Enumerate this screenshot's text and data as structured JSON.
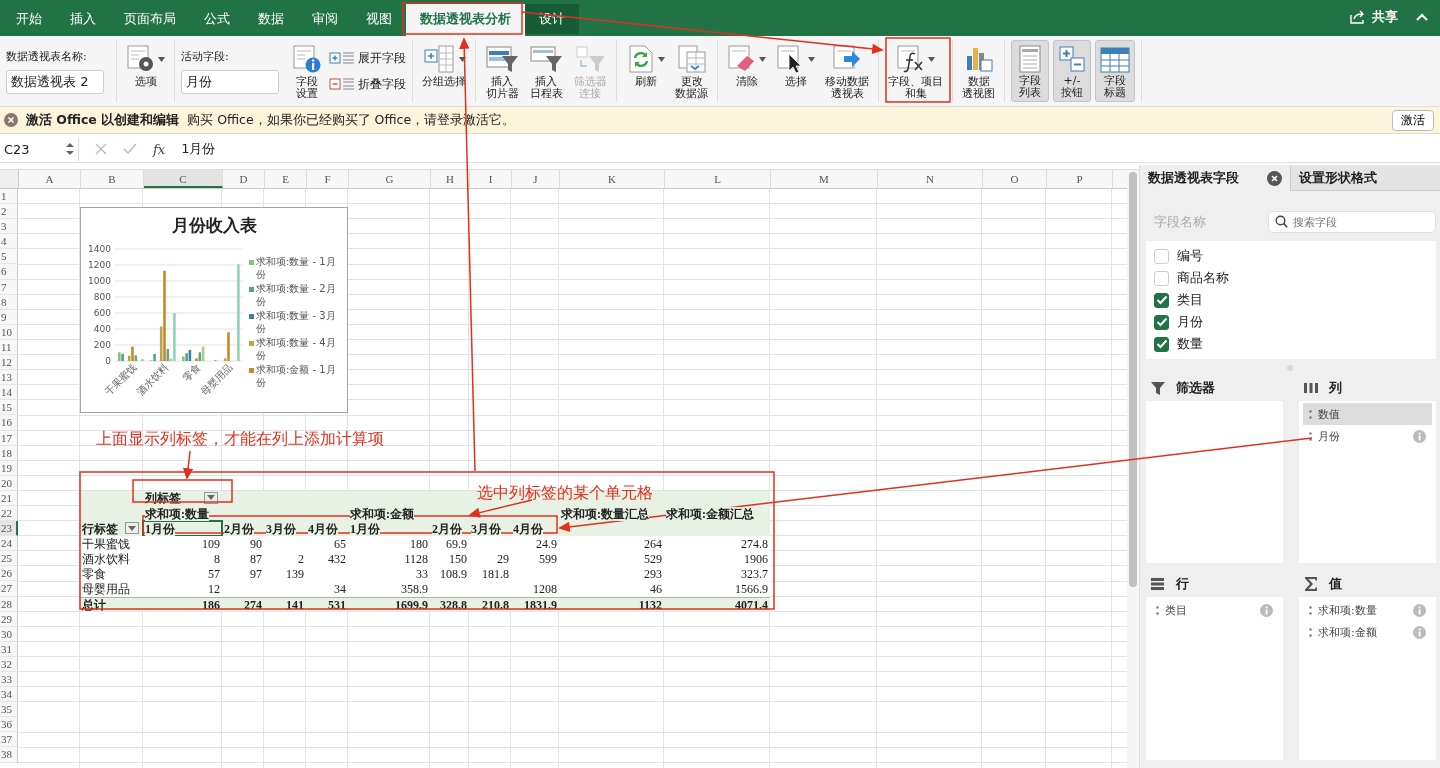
{
  "tabs": [
    {
      "label": "开始",
      "selected": false,
      "contextual": false
    },
    {
      "label": "插入",
      "selected": false,
      "contextual": false
    },
    {
      "label": "页面布局",
      "selected": false,
      "contextual": false
    },
    {
      "label": "公式",
      "selected": false,
      "contextual": false
    },
    {
      "label": "数据",
      "selected": false,
      "contextual": false
    },
    {
      "label": "审阅",
      "selected": false,
      "contextual": false
    },
    {
      "label": "视图",
      "selected": false,
      "contextual": false
    },
    {
      "label": "数据透视表分析",
      "selected": true,
      "contextual": true
    },
    {
      "label": "设计",
      "selected": false,
      "contextual": true
    }
  ],
  "share": {
    "label": "共享"
  },
  "ribbon": {
    "groups": [
      {
        "items": [
          {
            "kind": "field",
            "label": "数据透视表名称:",
            "value": "数据透视表 2"
          }
        ]
      },
      {
        "items": [
          {
            "kind": "large",
            "lines": [
              "选项"
            ],
            "caret": true
          }
        ]
      },
      {
        "items": [
          {
            "kind": "field",
            "label": "活动字段:",
            "value": "月份"
          },
          {
            "kind": "large",
            "lines": [
              "字段",
              "设置"
            ]
          },
          {
            "kind": "pair",
            "buttons": [
              {
                "label": "展开字段"
              },
              {
                "label": "折叠字段"
              }
            ]
          }
        ]
      },
      {
        "items": [
          {
            "kind": "large",
            "lines": [
              "分组选择"
            ],
            "caret": true
          }
        ]
      },
      {
        "items": [
          {
            "kind": "large",
            "lines": [
              "插入",
              "切片器"
            ],
            "disabled": false
          },
          {
            "kind": "large",
            "lines": [
              "插入",
              "日程表"
            ],
            "disabled": false
          },
          {
            "kind": "large",
            "lines": [
              "筛选器",
              "连接"
            ],
            "disabled": true
          }
        ]
      },
      {
        "items": [
          {
            "kind": "large",
            "lines": [
              "刷新"
            ],
            "caret": true
          },
          {
            "kind": "large",
            "lines": [
              "更改",
              "数据源"
            ]
          }
        ]
      },
      {
        "items": [
          {
            "kind": "large",
            "lines": [
              "清除"
            ],
            "caret": true
          },
          {
            "kind": "large",
            "lines": [
              "选择"
            ],
            "caret": true
          },
          {
            "kind": "large",
            "lines": [
              "移动数据",
              "透视表"
            ]
          }
        ]
      },
      {
        "items": [
          {
            "kind": "large",
            "lines": [
              "字段、项目",
              "和集"
            ],
            "caret": true
          }
        ]
      },
      {
        "items": [
          {
            "kind": "large",
            "lines": [
              "数据",
              "透视图"
            ]
          }
        ]
      },
      {
        "items": [
          {
            "kind": "large",
            "lines": [
              "字段",
              "列表"
            ],
            "on": true
          },
          {
            "kind": "large",
            "lines": [
              "+/-",
              "按钮"
            ],
            "on": true
          },
          {
            "kind": "large",
            "lines": [
              "字段",
              "标题"
            ],
            "on": true
          }
        ]
      }
    ]
  },
  "message_bar": {
    "title": "激活 Office 以创建和编辑",
    "text": "购买 Office，如果你已经购买了 Office，请登录激活它。",
    "button": "激活"
  },
  "formula_bar": {
    "name_box": "C23",
    "function_label": "fx",
    "value": "1月份"
  },
  "sheet": {
    "columns": [
      {
        "letter": "A",
        "selected": false
      },
      {
        "letter": "B",
        "selected": false
      },
      {
        "letter": "C",
        "selected": true
      },
      {
        "letter": "D",
        "selected": false
      },
      {
        "letter": "E",
        "selected": false
      },
      {
        "letter": "F",
        "selected": false
      },
      {
        "letter": "G",
        "selected": false
      },
      {
        "letter": "H",
        "selected": false
      },
      {
        "letter": "I",
        "selected": false
      },
      {
        "letter": "J",
        "selected": false
      },
      {
        "letter": "K",
        "selected": false
      },
      {
        "letter": "L",
        "selected": false
      },
      {
        "letter": "M",
        "selected": false
      },
      {
        "letter": "N",
        "selected": false
      },
      {
        "letter": "O",
        "selected": false
      },
      {
        "letter": "P",
        "selected": false
      }
    ],
    "rows": [
      {
        "number": "1",
        "selected": false
      },
      {
        "number": "2",
        "selected": false
      },
      {
        "number": "3",
        "selected": false
      },
      {
        "number": "4",
        "selected": false
      },
      {
        "number": "5",
        "selected": false
      },
      {
        "number": "6",
        "selected": false
      },
      {
        "number": "7",
        "selected": false
      },
      {
        "number": "8",
        "selected": false
      },
      {
        "number": "9",
        "selected": false
      },
      {
        "number": "10",
        "selected": false
      },
      {
        "number": "11",
        "selected": false
      },
      {
        "number": "12",
        "selected": false
      },
      {
        "number": "13",
        "selected": false
      },
      {
        "number": "14",
        "selected": false
      },
      {
        "number": "15",
        "selected": false
      },
      {
        "number": "16",
        "selected": false
      },
      {
        "number": "17",
        "selected": false
      },
      {
        "number": "18",
        "selected": false
      },
      {
        "number": "19",
        "selected": false
      },
      {
        "number": "20",
        "selected": false
      },
      {
        "number": "21",
        "selected": false,
        "kind": "pivot_head",
        "cells": [
          null,
          null,
          {
            "text": "列标签",
            "dropdown": true
          }
        ]
      },
      {
        "number": "22",
        "selected": false,
        "kind": "pivot_head",
        "cells": [
          null,
          null,
          "求和项:数量",
          null,
          null,
          null,
          "求和项:金额",
          null,
          null,
          null,
          "求和项:数量汇总",
          "求和项:金额汇总"
        ]
      },
      {
        "number": "23",
        "selected": true,
        "kind": "pivot_head",
        "cells": [
          null,
          {
            "text": "行标签",
            "dropdown": true
          },
          "1月份",
          "2月份",
          "3月份",
          "4月份",
          "1月份",
          "2月份",
          "3月份",
          "4月份"
        ]
      },
      {
        "number": "24",
        "selected": false,
        "kind": "pivot_data",
        "cells": [
          null,
          "干果蜜饯",
          "109",
          "90",
          null,
          "65",
          "180",
          "69.9",
          null,
          "24.9",
          "264",
          "274.8"
        ]
      },
      {
        "number": "25",
        "selected": false,
        "kind": "pivot_data",
        "cells": [
          null,
          "酒水饮料",
          "8",
          "87",
          "2",
          "432",
          "1128",
          "150",
          "29",
          "599",
          "529",
          "1906"
        ]
      },
      {
        "number": "26",
        "selected": false,
        "kind": "pivot_data",
        "cells": [
          null,
          "零食",
          "57",
          "97",
          "139",
          null,
          "33",
          "108.9",
          "181.8",
          null,
          "293",
          "323.7"
        ]
      },
      {
        "number": "27",
        "selected": false,
        "kind": "pivot_data",
        "cells": [
          null,
          "母婴用品",
          "12",
          null,
          null,
          "34",
          "358.9",
          null,
          null,
          "1208",
          "46",
          "1566.9"
        ]
      },
      {
        "number": "28",
        "selected": false,
        "kind": "pivot_total",
        "cells": [
          null,
          "总计",
          "186",
          "274",
          "141",
          "531",
          "1699.9",
          "328.8",
          "210.8",
          "1831.9",
          "1132",
          "4071.4"
        ]
      },
      {
        "number": "29",
        "selected": false
      },
      {
        "number": "30",
        "selected": false
      },
      {
        "number": "31",
        "selected": false
      },
      {
        "number": "32",
        "selected": false
      },
      {
        "number": "33",
        "selected": false
      },
      {
        "number": "34",
        "selected": false
      },
      {
        "number": "35",
        "selected": false
      },
      {
        "number": "36",
        "selected": false
      },
      {
        "number": "37",
        "selected": false
      },
      {
        "number": "38",
        "selected": false
      }
    ]
  },
  "chart": {
    "chart_data": {
      "type": "bar",
      "title": "月份收入表",
      "categories": [
        "干果蜜饯",
        "酒水饮料",
        "零食",
        "母婴用品"
      ],
      "ylim": [
        0,
        1400
      ],
      "yticks": [
        0,
        200,
        400,
        600,
        800,
        1000,
        1200,
        1400
      ],
      "grid": true,
      "legend": true,
      "series": [
        {
          "name": "求和项:数量 - 1月份",
          "color": "#8dc07a",
          "values": [
            109,
            8,
            57,
            12
          ]
        },
        {
          "name": "求和项:数量 - 2月份",
          "color": "#4fa585",
          "values": [
            90,
            87,
            97,
            null
          ]
        },
        {
          "name": "求和项:数量 - 3月份",
          "color": "#3d7fb6",
          "values": [
            null,
            null,
            139,
            null
          ]
        },
        {
          "name": "求和项:数量 - 4月份",
          "color": "#b5a847",
          "values": [
            65,
            432,
            null,
            34
          ]
        },
        {
          "name": "求和项:金额 - 1月份",
          "color": "#c8882e",
          "values": [
            180,
            1128,
            33,
            358.9
          ]
        },
        {
          "color": "#6aa574",
          "values": [
            69.9,
            150,
            108.9,
            null
          ]
        },
        {
          "color": "#a6cf8c",
          "values": [
            null,
            29,
            181.8,
            null
          ]
        },
        {
          "color": "#8fd3b6",
          "values": [
            24.9,
            599,
            null,
            1208
          ]
        }
      ]
    }
  },
  "annotations": [
    "上面显示列标签，才能在列上添加计算项",
    "选中列标签的某个单元格"
  ],
  "field_pane": {
    "tabs": [
      {
        "label": "数据透视表字段",
        "selected": true
      },
      {
        "label": "设置形状格式",
        "selected": false
      }
    ],
    "field_name_label": "字段名称",
    "search": {
      "placeholder": "搜索字段"
    },
    "fields": [
      {
        "label": "编号",
        "checked": false
      },
      {
        "label": "商品名称",
        "checked": false
      },
      {
        "label": "类目",
        "checked": true
      },
      {
        "label": "月份",
        "checked": true
      },
      {
        "label": "数量",
        "checked": true
      }
    ],
    "areas": [
      {
        "kind": "filter",
        "title": "筛选器"
      },
      {
        "kind": "columns",
        "title": "列",
        "items": [
          {
            "label": "数值",
            "selected": true
          },
          {
            "label": "月份",
            "selected": false,
            "info": true
          }
        ]
      },
      {
        "kind": "rows",
        "title": "行",
        "items": [
          {
            "label": "类目",
            "selected": false,
            "info": true
          }
        ]
      },
      {
        "kind": "values",
        "title": "值",
        "items": [
          {
            "label": "求和项:数量",
            "selected": false,
            "info": true
          },
          {
            "label": "求和项:金额",
            "selected": false,
            "info": true
          }
        ]
      }
    ]
  }
}
